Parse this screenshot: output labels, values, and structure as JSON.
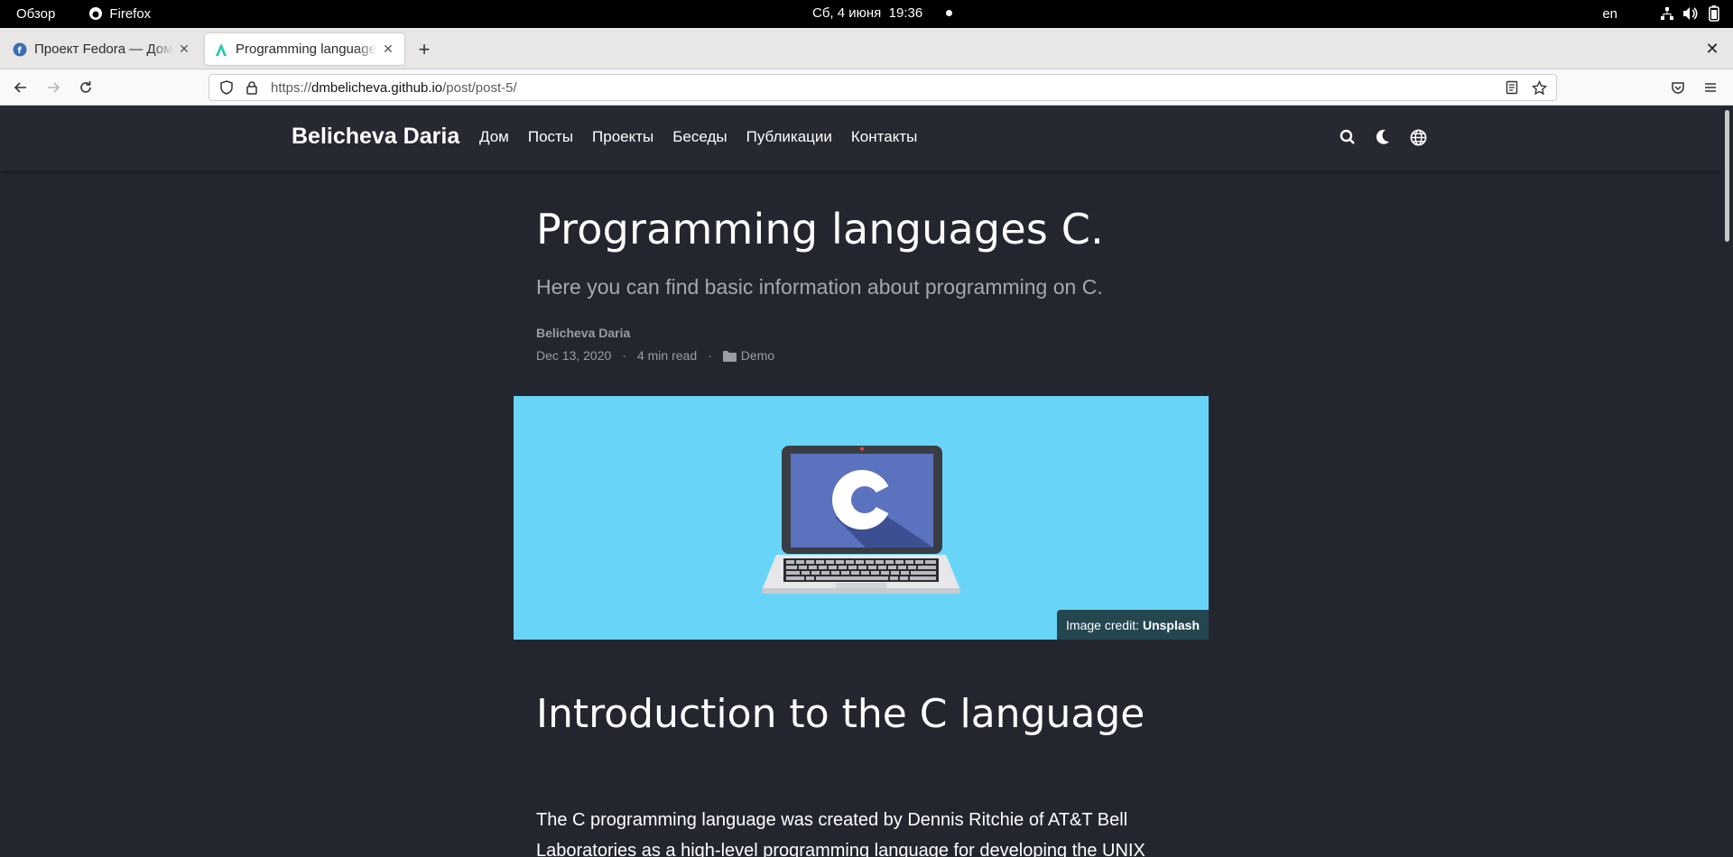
{
  "system": {
    "overview_label": "Обзор",
    "app_label": "Firefox",
    "clock": "Сб, 4 июня  19:36",
    "lang": "en"
  },
  "browser": {
    "tabs": [
      {
        "title": "Проект Fedora — Домашняя",
        "active": false
      },
      {
        "title": "Programming languages C.",
        "active": true
      }
    ],
    "url_scheme": "https://",
    "url_host": "dmbelicheva.github.io",
    "url_path": "/post/post-5/"
  },
  "site": {
    "brand": "Belicheva Daria",
    "menu": [
      "Дом",
      "Посты",
      "Проекты",
      "Беседы",
      "Публикации",
      "Контакты"
    ]
  },
  "post": {
    "title": "Programming languages C.",
    "subtitle": "Here you can find basic information about programming on C.",
    "author": "Belicheva Daria",
    "date": "Dec 13, 2020",
    "sep": "·",
    "read_time": "4 min read",
    "category": "Demo",
    "image_credit_prefix": "Image credit:",
    "image_credit_source": "Unsplash",
    "section_heading": "Introduction to the C language",
    "paragraph": "The C programming language was created by Dennis Ritchie of AT&T Bell Laboratories as a high-level programming language for developing the UNIX"
  },
  "colors": {
    "page_bg": "#24262f",
    "hero_bg": "#68d5f8",
    "laptop_screen": "#5b72bf"
  }
}
